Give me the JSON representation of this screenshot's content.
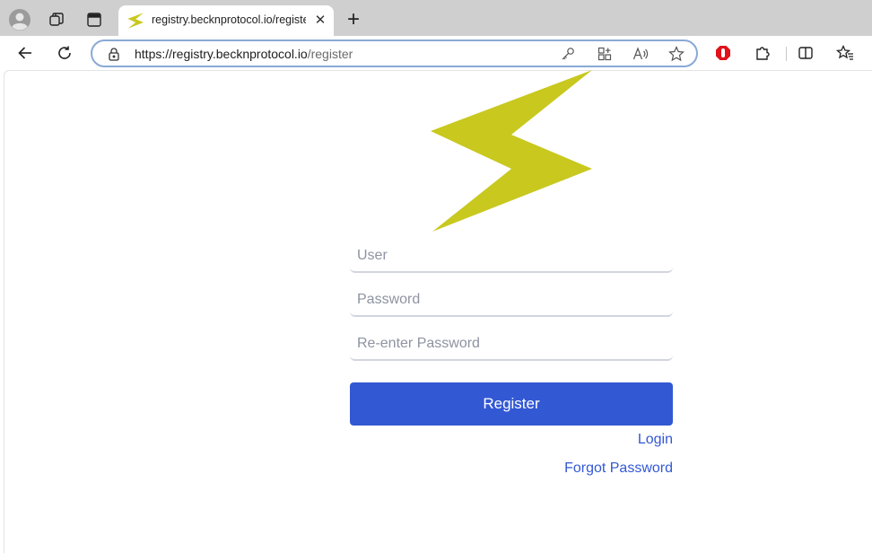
{
  "browser": {
    "tab": {
      "title": "registry.becknprotocol.io/register",
      "close_glyph": "✕",
      "favicon": "lightning-icon"
    },
    "new_tab_glyph": "+",
    "address": {
      "url_host": "https://registry.becknprotocol.io",
      "url_path": "/register"
    },
    "icons": [
      "profile-icon",
      "workspaces-icon",
      "tab-actions-icon",
      "back-icon",
      "refresh-icon",
      "lock-icon",
      "key-icon",
      "apps-icon",
      "read-aloud-icon",
      "favorite-star-icon",
      "adblock-icon",
      "extensions-icon",
      "split-screen-icon",
      "favorites-icon"
    ]
  },
  "form": {
    "user_placeholder": "User",
    "password_placeholder": "Password",
    "reenter_placeholder": "Re-enter Password",
    "register_label": "Register",
    "login_link": "Login",
    "forgot_link": "Forgot Password"
  },
  "colors": {
    "logo": "#c8c81f",
    "primary": "#3358d4",
    "tabbar_bg": "#cfcfcf",
    "adblock_red": "#e0121b"
  }
}
